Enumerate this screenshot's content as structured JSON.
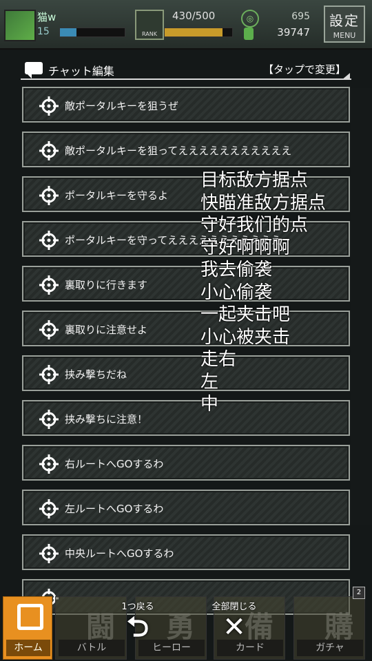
{
  "status_bar": {
    "player_name": "猫w",
    "player_level": "15",
    "exp_progress": 0.25,
    "rank_label": "RANK",
    "stamina": "430/500",
    "stamina_progress": 0.86,
    "gem_count": "695",
    "coin_count": "39747",
    "menu_kanji": "設定",
    "menu_label": "MENU"
  },
  "panel": {
    "title": "チャット編集",
    "action_label": "【タップで変更】",
    "items": [
      {
        "label": "敵ポータルキーを狙うぜ"
      },
      {
        "label": "敵ポータルキーを狙ってえええええええええええ"
      },
      {
        "label": "ポータルキーを守るよ"
      },
      {
        "label": "ポータルキーを守ってえええええええええええ"
      },
      {
        "label": "裏取りに行きます"
      },
      {
        "label": "裏取りに注意せよ"
      },
      {
        "label": "挟み撃ちだね"
      },
      {
        "label": "挟み撃ちに注意！"
      },
      {
        "label": "右ルートへGOするわ"
      },
      {
        "label": "左ルートへGOするわ"
      },
      {
        "label": "中央ルートへGOするわ"
      },
      {
        "label": ""
      }
    ]
  },
  "annotations": [
    "目标敌方据点",
    "快瞄准敌方据点",
    "守好我们的点",
    "守好啊啊啊",
    "我去偷袭",
    "小心偷袭",
    "一起夹击吧",
    "小心被夹击",
    "走右",
    "左",
    "中"
  ],
  "bottom_nav": {
    "back_label": "1つ戻る",
    "close_all_label": "全部閉じる",
    "badge": "2",
    "tabs": [
      {
        "label": "ホーム",
        "kanji": ""
      },
      {
        "label": "バトル",
        "kanji": "闘"
      },
      {
        "label": "ヒーロー",
        "kanji": "勇"
      },
      {
        "label": "カード",
        "kanji": "備"
      },
      {
        "label": "ガチャ",
        "kanji": "購"
      }
    ]
  },
  "colors": {
    "panel_bg": "#1b2020",
    "item_border": "#9aa09a",
    "home_tab": "#e89020",
    "exp_bar": "#3b8bb5",
    "stamina_bar": "#c89b2a"
  }
}
